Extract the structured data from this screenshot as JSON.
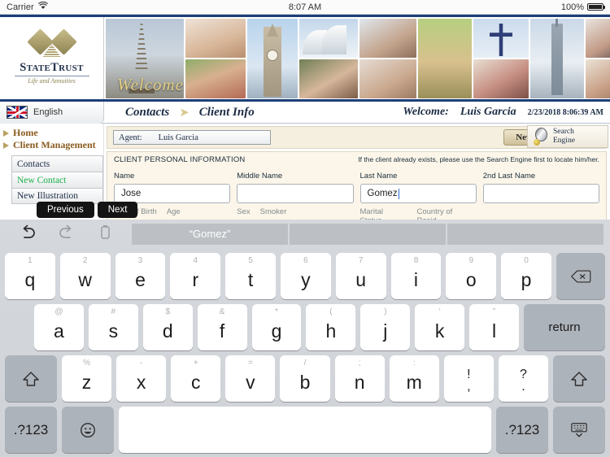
{
  "status_bar": {
    "carrier": "Carrier",
    "wifi_icon": "wifi-icon",
    "time": "8:07 AM",
    "battery_percent": "100%"
  },
  "brand": {
    "name_part1": "S",
    "name_part2": "TATE",
    "name_part3": "T",
    "name_part4": "RUST",
    "tagline": "Life and Annuities",
    "banner_overlay": "Welcome"
  },
  "nav": {
    "language": "English",
    "flag_icon": "uk-flag-icon",
    "breadcrumb": {
      "parent": "Contacts",
      "separator": "➤",
      "current": "Client Info"
    },
    "welcome_label": "Welcome:",
    "welcome_user": "Luis Garcia",
    "timestamp": "2/23/2018 8:06:39 AM"
  },
  "sidebar": {
    "links": [
      {
        "label": "Home",
        "icon": "triangle-bullet-icon"
      },
      {
        "label": "Client Management",
        "icon": "triangle-bullet-icon"
      }
    ],
    "items": [
      {
        "label": "Contacts",
        "state": "normal"
      },
      {
        "label": "New Contact",
        "state": "active"
      },
      {
        "label": "New Illustration",
        "state": "normal"
      }
    ]
  },
  "agent_bar": {
    "label": "Agent:",
    "value": "Luis Garcia",
    "new_contact_button": "New Contact"
  },
  "search_panel": {
    "icon": "magnifier-icon",
    "line1": "Search",
    "line2": "Engine"
  },
  "form": {
    "title": "CLIENT PERSONAL INFORMATION",
    "hint": "If the client already exists, please use the Search Engine first to locate him/her.",
    "fields": [
      {
        "label": "Name",
        "value": "Jose",
        "focused": false
      },
      {
        "label": "Middle Name",
        "value": "",
        "focused": false
      },
      {
        "label": "Last Name",
        "value": "Gomez",
        "focused": true
      },
      {
        "label": "2nd Last Name",
        "value": "",
        "focused": false
      }
    ],
    "next_labels": [
      "Date of Birth",
      "Age",
      "Sex",
      "Smoker",
      "Marital Status",
      "Country of Resid."
    ]
  },
  "accessory": {
    "previous": "Previous",
    "next": "Next"
  },
  "keyboard": {
    "predictive": {
      "undo_icon": "undo-icon",
      "redo_icon": "redo-icon",
      "paste_icon": "paste-icon",
      "suggestions": [
        "“Gomez”",
        "",
        ""
      ]
    },
    "row1": [
      {
        "alt": "1",
        "main": "q"
      },
      {
        "alt": "2",
        "main": "w"
      },
      {
        "alt": "3",
        "main": "e"
      },
      {
        "alt": "4",
        "main": "r"
      },
      {
        "alt": "5",
        "main": "t"
      },
      {
        "alt": "6",
        "main": "y"
      },
      {
        "alt": "7",
        "main": "u"
      },
      {
        "alt": "8",
        "main": "i"
      },
      {
        "alt": "9",
        "main": "o"
      },
      {
        "alt": "0",
        "main": "p"
      }
    ],
    "delete_icon": "delete-key-icon",
    "row2": [
      {
        "alt": "@",
        "main": "a"
      },
      {
        "alt": "#",
        "main": "s"
      },
      {
        "alt": "$",
        "main": "d"
      },
      {
        "alt": "&",
        "main": "f"
      },
      {
        "alt": "*",
        "main": "g"
      },
      {
        "alt": "(",
        "main": "h"
      },
      {
        "alt": ")",
        "main": "j"
      },
      {
        "alt": "‘",
        "main": "k"
      },
      {
        "alt": "”",
        "main": "l"
      }
    ],
    "return_label": "return",
    "row3": [
      {
        "alt": "%",
        "main": "z"
      },
      {
        "alt": "-",
        "main": "x"
      },
      {
        "alt": "+",
        "main": "c"
      },
      {
        "alt": "=",
        "main": "v"
      },
      {
        "alt": "/",
        "main": "b"
      },
      {
        "alt": ";",
        "main": "n"
      },
      {
        "alt": ":",
        "main": "m"
      }
    ],
    "row3_punct": [
      {
        "up": "!",
        "lo": ","
      },
      {
        "up": "?",
        "lo": "."
      }
    ],
    "shift_left_icon": "shift-key-icon",
    "shift_right_icon": "shift-key-icon",
    "row4": {
      "numbers_left": ".?123",
      "emoji_icon": "emoji-key-icon",
      "space": "",
      "numbers_right": ".?123",
      "hide_icon": "hide-keyboard-icon"
    }
  }
}
